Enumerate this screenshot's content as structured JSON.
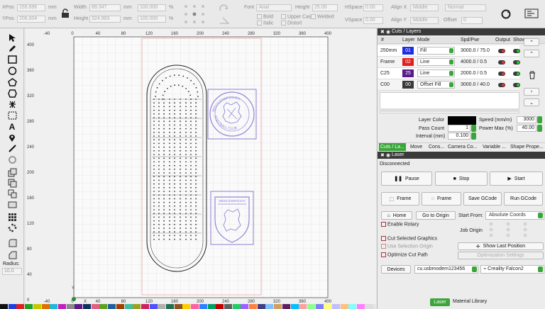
{
  "toolbar": {
    "xpos_label": "XPos",
    "xpos_value": "159.896",
    "xpos_unit": "mm",
    "ypos_label": "YPos",
    "ypos_value": "206.604",
    "ypos_unit": "mm",
    "width_label": "Width",
    "width_value": "89.347",
    "width_unit": "mm",
    "height_label": "Height",
    "height_value": "324.983",
    "height_unit": "mm",
    "scale_w": "100.000",
    "scale_h": "100.000",
    "pct": "%",
    "font_label": "Font",
    "font_value": "Arial",
    "text_height_label": "Height",
    "text_height_value": "25.00",
    "bold_label": "Bold",
    "italic_label": "Italic",
    "upper_case_label": "Upper Case",
    "welded_label": "Welded",
    "distort_label": "Distort",
    "hspace_label": "HSpace",
    "hspace_value": "0.00",
    "vspace_label": "VSpace",
    "vspace_value": "0.00",
    "alignx_label": "Align X",
    "alignx_value": "Middle",
    "aligny_label": "Align Y",
    "aligny_value": "Middle",
    "normal_value": "Normal",
    "offset_label": "Offset",
    "offset_value": "0"
  },
  "left_tools": {
    "radius_label": "Radius:",
    "radius_value": "10.0"
  },
  "canvas": {
    "top_ruler": [
      "-40",
      "0",
      "40",
      "80",
      "120",
      "160",
      "200",
      "240",
      "280",
      "320",
      "360",
      "400"
    ],
    "bottom_ruler": [
      "-40",
      "0",
      "40",
      "80",
      "120",
      "160",
      "200",
      "240",
      "280",
      "320",
      "360",
      "400"
    ],
    "left_ruler": [
      "400",
      "360",
      "320",
      "280",
      "240",
      "200",
      "160",
      "120",
      "80",
      "40",
      "0"
    ],
    "crest_text_top": "MIDDLESBROUGH",
    "crest_text_bottom": "FOOTBALL CLUB",
    "axis_x": "X",
    "axis_y": "Y"
  },
  "cuts_panel": {
    "title": "Cuts / Layers",
    "headers": [
      "#",
      "Layer",
      "Mode",
      "Spd/Pwr",
      "Output",
      "Show"
    ],
    "rows": [
      {
        "name": "250mm",
        "layer": "01",
        "color": "#1f2fe0",
        "mode": "Fill",
        "spd": "3000.0 / 75.0"
      },
      {
        "name": "Frame",
        "layer": "02",
        "color": "#e0201c",
        "mode": "Line",
        "spd": "4000.0 / 0.5"
      },
      {
        "name": "C25",
        "layer": "25",
        "color": "#5a1a8a",
        "mode": "Line",
        "spd": "2000.0 / 0.5"
      },
      {
        "name": "C00",
        "layer": "00",
        "color": "#3a3a3a",
        "mode": "Offset Fill",
        "spd": "3000.0 / 40.0"
      }
    ],
    "layer_color_label": "Layer Color",
    "pass_count_label": "Pass Count",
    "pass_count_value": "1",
    "interval_label": "Interval (mm)",
    "interval_value": "0.100",
    "speed_label": "Speed (mm/m)",
    "speed_value": "3000",
    "power_label": "Power Max (%)",
    "power_value": "40.00",
    "tabs": [
      "Cuts / La...",
      "Move",
      "Cons...",
      "Camera Co...",
      "Variable ...",
      "Shape Prope..."
    ]
  },
  "laser_panel": {
    "title": "Laser",
    "status": "Disconnected",
    "pause": "Pause",
    "stop": "Stop",
    "start": "Start",
    "frame1": "Frame",
    "frame2": "Frame",
    "save_gcode": "Save GCode",
    "run_gcode": "Run GCode",
    "home": "Home",
    "go_to_origin": "Go to Origin",
    "start_from_label": "Start From:",
    "start_from_value": "Absolute Coords",
    "enable_rotary": "Enable Rotary",
    "job_origin_label": "Job Origin",
    "cut_selected": "Cut Selected Graphics",
    "use_selection_origin": "Use Selection Origin",
    "optimize_cut_path": "Optimize Cut Path",
    "show_last_position": "Show Last Position",
    "optimization_settings": "Optimization Settings",
    "devices": "Devices",
    "port": "cu.usbmodem123456",
    "machine": "Creality Falcon2",
    "tab_laser": "Laser",
    "tab_material": "Material Library"
  },
  "palette_colors": [
    "#111111",
    "#1f3fe0",
    "#e02020",
    "#20a020",
    "#c8c800",
    "#e07000",
    "#20b8d8",
    "#c020c0",
    "#8a8a8a",
    "#5a1a8a",
    "#103060",
    "#e06080",
    "#60a020",
    "#2060a0",
    "#a04000",
    "#40c0a0",
    "#a0a020",
    "#d02060",
    "#5050ff",
    "#b0b0b0",
    "#207050",
    "#905020",
    "#ffcc00",
    "#ff60a0",
    "#3080ff",
    "#00a060",
    "#c00000",
    "#606060",
    "#20d060",
    "#a060ff",
    "#ff8040",
    "#404080",
    "#80c0ff",
    "#d0a060",
    "#602060",
    "#00c0ff",
    "#ffa0a0",
    "#90ff90",
    "#8080ff",
    "#ffff80",
    "#c0c0ff",
    "#ffc080",
    "#80ffff",
    "#ff80ff",
    "#dddddd"
  ]
}
